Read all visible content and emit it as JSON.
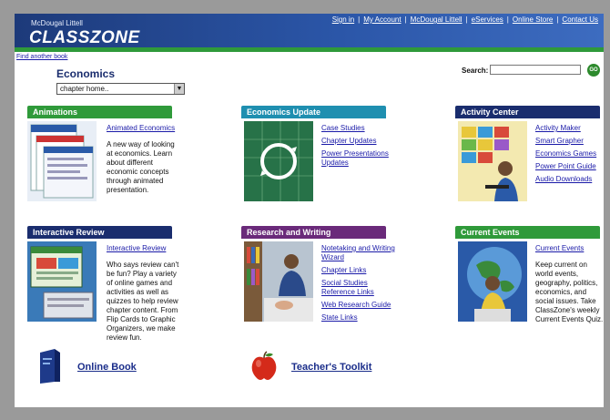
{
  "header": {
    "brand_small": "McDougal Littell",
    "brand_main": "CLASSZONE",
    "top_links": [
      "Sign in",
      "My Account",
      "McDougal Littell",
      "eServices",
      "Online Store",
      "Contact Us"
    ]
  },
  "find_book": "Find another book",
  "subject": "Economics",
  "chapter_select": {
    "value": "chapter home.."
  },
  "search": {
    "label": "Search:",
    "value": "",
    "go": "GO"
  },
  "sections": {
    "animations": {
      "title": "Animations",
      "color": "#2f9a3a",
      "links": [
        "Animated Economics"
      ],
      "description": "A new way of looking at economics. Learn about different economic concepts through animated presentation."
    },
    "economics_update": {
      "title": "Economics Update",
      "color": "#1f8fb0",
      "links": [
        "Case Studies",
        "Chapter Updates",
        "Power Presentations Updates"
      ]
    },
    "activity_center": {
      "title": "Activity Center",
      "color": "#1a2d6e",
      "links": [
        "Activity Maker",
        "Smart Grapher",
        "Economics Games",
        "Power Point Guide",
        "Audio Downloads"
      ]
    },
    "interactive_review": {
      "title": "Interactive Review",
      "color": "#1a2d6e",
      "links": [
        "Interactive Review"
      ],
      "description": "Who says review can't be fun? Play a variety of online games and activities as well as quizzes to help review chapter content. From Flip Cards to Graphic Organizers, we make review fun."
    },
    "research_writing": {
      "title": "Research and Writing",
      "color": "#6a2a7a",
      "links": [
        "Notetaking and Writing Wizard",
        "Chapter Links",
        "Social Studies Reference Links",
        "Web Research Guide",
        "State Links"
      ]
    },
    "current_events": {
      "title": "Current Events",
      "color": "#2f9a3a",
      "links": [
        "Current Events"
      ],
      "description": "Keep current on world events, geography, politics, economics, and social issues. Take ClassZone's weekly Current Events Quiz."
    }
  },
  "bottom": {
    "online_book": "Online Book",
    "teachers_toolkit": "Teacher's Toolkit"
  }
}
